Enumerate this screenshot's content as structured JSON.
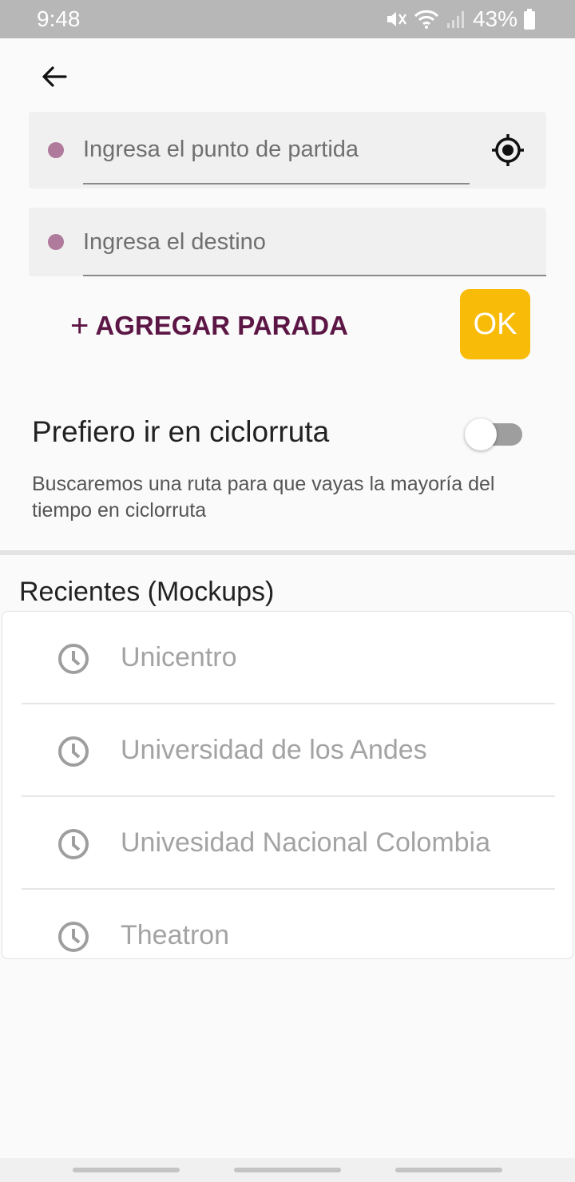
{
  "status_bar": {
    "time": "9:48",
    "battery": "43%"
  },
  "route_form": {
    "origin_placeholder": "Ingresa el punto de partida",
    "destination_placeholder": "Ingresa el destino",
    "add_stop_label": "AGREGAR PARADA",
    "add_stop_icon": "+",
    "ok_label": "OK"
  },
  "preference": {
    "title": "Prefiero ir en ciclorruta",
    "description": "Buscaremos una ruta para que vayas la mayoría del tiempo en ciclorruta",
    "enabled": false
  },
  "recents": {
    "title": "Recientes (Mockups)",
    "items": [
      {
        "label": "Unicentro",
        "icon": "clock-icon"
      },
      {
        "label": "Universidad de los Andes",
        "icon": "clock-icon"
      },
      {
        "label": "Univesidad Nacional Colombia",
        "icon": "clock-icon"
      },
      {
        "label": "Theatron",
        "icon": "clock-icon"
      }
    ]
  },
  "colors": {
    "accent_purple": "#5c1645",
    "dot_purple": "#b07a9c",
    "ok_yellow": "#f8bb08",
    "status_bar": "#b7b7b7"
  }
}
